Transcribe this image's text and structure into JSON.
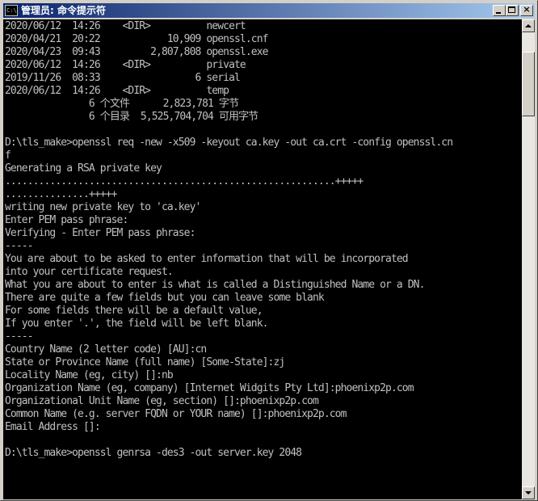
{
  "window": {
    "title": "管理员: 命令提示符",
    "icon_label": "C:\\"
  },
  "console": {
    "lines": [
      "2020/06/12  14:26    <DIR>          newcert",
      "2020/04/21  20:22            10,909 openssl.cnf",
      "2020/04/23  09:43         2,807,808 openssl.exe",
      "2020/06/12  14:26    <DIR>          private",
      "2019/11/26  08:33                 6 serial",
      "2020/06/12  14:26    <DIR>          temp",
      "               6 个文件      2,823,781 字节",
      "               6 个目录  5,525,704,704 可用字节",
      "",
      "D:\\tls_make>openssl req -new -x509 -keyout ca.key -out ca.crt -config openssl.cn",
      "f",
      "Generating a RSA private key",
      "...........................................................+++++",
      "...............+++++",
      "writing new private key to 'ca.key'",
      "Enter PEM pass phrase:",
      "Verifying - Enter PEM pass phrase:",
      "-----",
      "You are about to be asked to enter information that will be incorporated",
      "into your certificate request.",
      "What you are about to enter is what is called a Distinguished Name or a DN.",
      "There are quite a few fields but you can leave some blank",
      "For some fields there will be a default value,",
      "If you enter '.', the field will be left blank.",
      "-----",
      "Country Name (2 letter code) [AU]:cn",
      "State or Province Name (full name) [Some-State]:zj",
      "Locality Name (eg, city) []:nb",
      "Organization Name (eg, company) [Internet Widgits Pty Ltd]:phoenixp2p.com",
      "Organizational Unit Name (eg, section) []:phoenixp2p.com",
      "Common Name (e.g. server FQDN or YOUR name) []:phoenixp2p.com",
      "Email Address []:",
      "",
      "D:\\tls_make>openssl genrsa -des3 -out server.key 2048"
    ]
  },
  "colors": {
    "console_bg": "#000000",
    "console_fg": "#c0c0c0",
    "titlebar_start": "#0a246a",
    "titlebar_end": "#a6caf0",
    "chrome": "#d4d0c8"
  },
  "icons": {
    "app": "console-icon",
    "minimize": "minimize-icon",
    "maximize": "maximize-icon",
    "close": "close-icon",
    "scroll_up": "scroll-up-arrow-icon",
    "scroll_down": "scroll-down-arrow-icon"
  }
}
